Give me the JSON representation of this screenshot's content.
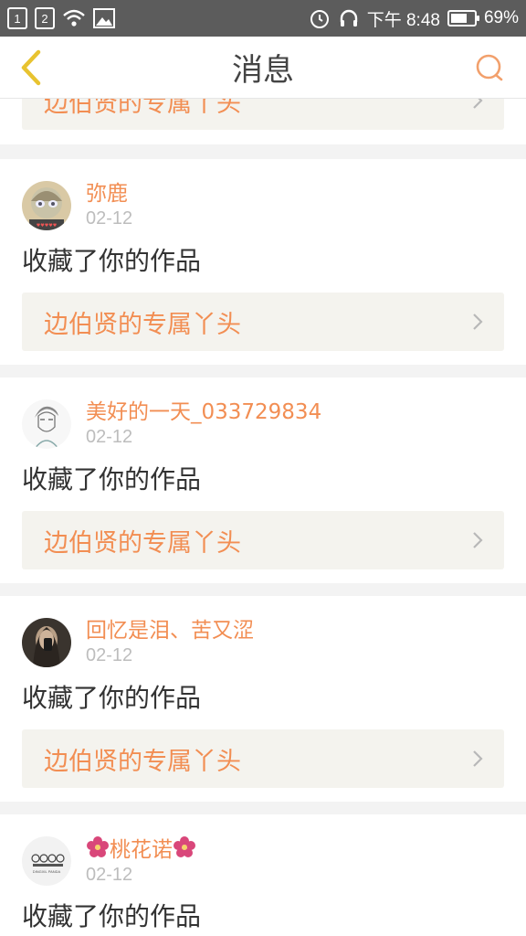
{
  "status_bar": {
    "sim1": "1",
    "sim2": "2",
    "time": "下午 8:48",
    "battery": "69%",
    "battery_level": 0.69
  },
  "header": {
    "title": "消息"
  },
  "notifications": [
    {
      "username": "",
      "date": "",
      "action": "",
      "work_title": "边伯贤的专属丫头"
    },
    {
      "username": "弥鹿",
      "date": "02-12",
      "action": "收藏了你的作品",
      "work_title": "边伯贤的专属丫头"
    },
    {
      "username": "美好的一天_033729834",
      "date": "02-12",
      "action": "收藏了你的作品",
      "work_title": "边伯贤的专属丫头"
    },
    {
      "username": "回忆是泪、苦又涩",
      "date": "02-12",
      "action": "收藏了你的作品",
      "work_title": "边伯贤的专属丫头"
    },
    {
      "username": "桃花诺",
      "date": "02-12",
      "action": "收藏了你的作品",
      "work_title": ""
    }
  ],
  "colors": {
    "accent": "#f28e53",
    "back_arrow": "#e8c330",
    "divider": "#f3f3f3",
    "link_bg": "#f4f3ee"
  }
}
